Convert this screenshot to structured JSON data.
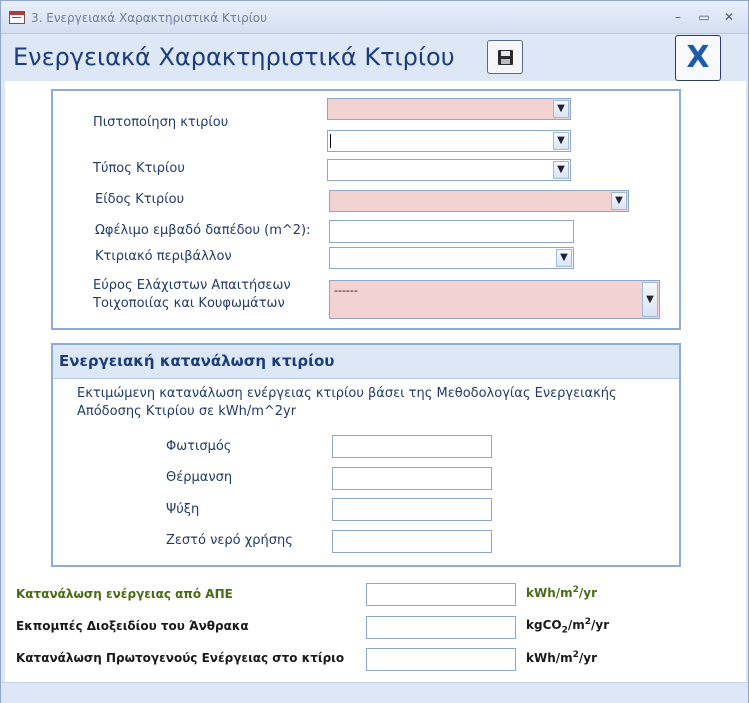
{
  "window": {
    "title": "3. Ενεργειακά Χαρακτηριστικά Κτιρίου"
  },
  "header": {
    "page_title": "Ενεργειακά Χαρακτηριστικά Κτιρίου",
    "close_label": "X"
  },
  "characteristics": {
    "certification_label": "Πιστοποίηση κτιρίου",
    "building_type_label": "Τύπος Κτιρίου",
    "building_kind_label": "Είδος Κτιρίου",
    "floor_area_label": "Ωφέλιμο εμβαδό δαπέδου (m^2):",
    "environment_label": "Κτιριακό περιβάλλον",
    "min_requirements_label": "Εύρος Ελάχιστων Απαιτήσεων Τοιχοποιίας και Κουφωμάτων",
    "min_requirements_value": "------"
  },
  "consumption": {
    "title": "Ενεργειακή κατανάλωση κτιρίου",
    "description": "Εκτιμώμενη κατανάλωση ενέργειας κτιρίου βάσει της Μεθοδολογίας Ενεργειακής Απόδοσης Κτιρίου σε kWh/m^2yr",
    "lighting_label": "Φωτισμός",
    "heating_label": "Θέρμανση",
    "cooling_label": "Ψύξη",
    "hot_water_label": "Ζεστό νερό χρήσης"
  },
  "totals": {
    "res_label": "Κατανάλωση ενέργειας από ΑΠΕ",
    "co2_label": "Εκπομπές Διοξειδίου του Άνθρακα",
    "primary_label": "Κατανάλωση Πρωτογενούς Ενέργειας στο κτίριο",
    "unit_kwh": "kWh/m",
    "unit_yr": "/yr",
    "unit_kgco": "kgCO",
    "sup2": "2",
    "sub2": "2"
  },
  "colors": {
    "accent": "#1d3d7a",
    "required_field": "#f2d2d2",
    "panel_border": "#8eadd6",
    "res_text": "#4a6b16"
  },
  "icons": {
    "save": "floppy-disk-icon",
    "close": "close-icon"
  }
}
